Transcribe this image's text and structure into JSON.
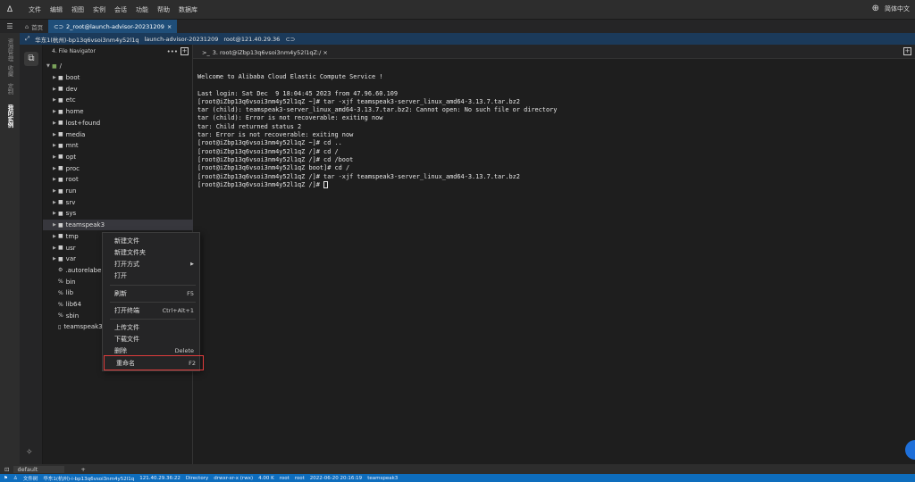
{
  "menubar": {
    "logo": "Δ",
    "items": [
      "文件",
      "编辑",
      "视图",
      "实例",
      "会话",
      "功能",
      "帮助",
      "数据库"
    ],
    "language": "简体中文"
  },
  "tabs": {
    "home": "首页",
    "active": "2_root@launch-advisor-20231209",
    "close": "×"
  },
  "infobar": {
    "region": "华东1(杭州)-bp13q6vsoi3nm4y52l1q",
    "host": "launch-advisor-20231209",
    "user": "root@121.40.29.36"
  },
  "activity": {
    "items": [
      "资源管理",
      "收藏",
      "定制",
      "我的实例"
    ]
  },
  "filenav": {
    "title": "4. File Navigator",
    "menu": "•••",
    "add": "+",
    "root": "/",
    "items": [
      {
        "name": "boot",
        "type": "folder"
      },
      {
        "name": "dev",
        "type": "folder"
      },
      {
        "name": "etc",
        "type": "folder"
      },
      {
        "name": "home",
        "type": "folder"
      },
      {
        "name": "lost+found",
        "type": "folder"
      },
      {
        "name": "media",
        "type": "folder"
      },
      {
        "name": "mnt",
        "type": "folder"
      },
      {
        "name": "opt",
        "type": "folder"
      },
      {
        "name": "proc",
        "type": "folder"
      },
      {
        "name": "root",
        "type": "folder"
      },
      {
        "name": "run",
        "type": "folder"
      },
      {
        "name": "srv",
        "type": "folder"
      },
      {
        "name": "sys",
        "type": "folder"
      },
      {
        "name": "teamspeak3",
        "type": "folder"
      },
      {
        "name": "tmp",
        "type": "folder"
      },
      {
        "name": "usr",
        "type": "folder"
      },
      {
        "name": "var",
        "type": "folder"
      },
      {
        "name": ".autorelabel",
        "type": "file"
      },
      {
        "name": "bin",
        "type": "link"
      },
      {
        "name": "lib",
        "type": "link"
      },
      {
        "name": "lib64",
        "type": "link"
      },
      {
        "name": "sbin",
        "type": "link"
      },
      {
        "name": "teamspeak3",
        "type": "archive"
      }
    ]
  },
  "terminal": {
    "tab_label": "3. root@iZbp13q6vsoi3nm4y52l1qZ:/",
    "tab_close": "×",
    "add": "+",
    "lines": [
      "Welcome to Alibaba Cloud Elastic Compute Service !",
      "",
      "Last login: Sat Dec  9 18:04:45 2023 from 47.96.60.109",
      "[root@iZbp13q6vsoi3nm4y52l1qZ ~]# tar -xjf teamspeak3-server_linux_amd64-3.13.7.tar.bz2",
      "tar (child): teamspeak3-server_linux_amd64-3.13.7.tar.bz2: Cannot open: No such file or directory",
      "tar (child): Error is not recoverable: exiting now",
      "tar: Child returned status 2",
      "tar: Error is not recoverable: exiting now",
      "[root@iZbp13q6vsoi3nm4y52l1qZ ~]# cd ..",
      "[root@iZbp13q6vsoi3nm4y52l1qZ /]# cd /",
      "[root@iZbp13q6vsoi3nm4y52l1qZ /]# cd /boot",
      "[root@iZbp13q6vsoi3nm4y52l1qZ boot]# cd /",
      "[root@iZbp13q6vsoi3nm4y52l1qZ /]# tar -xjf teamspeak3-server_linux_amd64-3.13.7.tar.bz2",
      "[root@iZbp13q6vsoi3nm4y52l1qZ /]# "
    ]
  },
  "context_menu": {
    "new_file": "新建文件",
    "new_folder": "新建文件夹",
    "open_with": "打开方式",
    "open": "打开",
    "refresh": "刷新",
    "refresh_sc": "F5",
    "open_terminal": "打开终端",
    "open_terminal_sc": "Ctrl+Alt+1",
    "upload": "上传文件",
    "download": "下载文件",
    "delete": "删除",
    "delete_sc": "Delete",
    "rename": "重命名",
    "rename_sc": "F2"
  },
  "bottom": {
    "session": "default",
    "add": "+"
  },
  "status": {
    "label": "文件树",
    "instance": "华东1(杭州)-i-bp13q6vsoi3nm4y52l1q",
    "ip": "121.40.29.36:22",
    "kind": "Directory",
    "perms": "drwxr-xr-x (rwx)",
    "size": "4.00 K",
    "owner": "root",
    "group": "root",
    "time": "2022-06-20 20:16:19",
    "name": "teamspeak3"
  }
}
